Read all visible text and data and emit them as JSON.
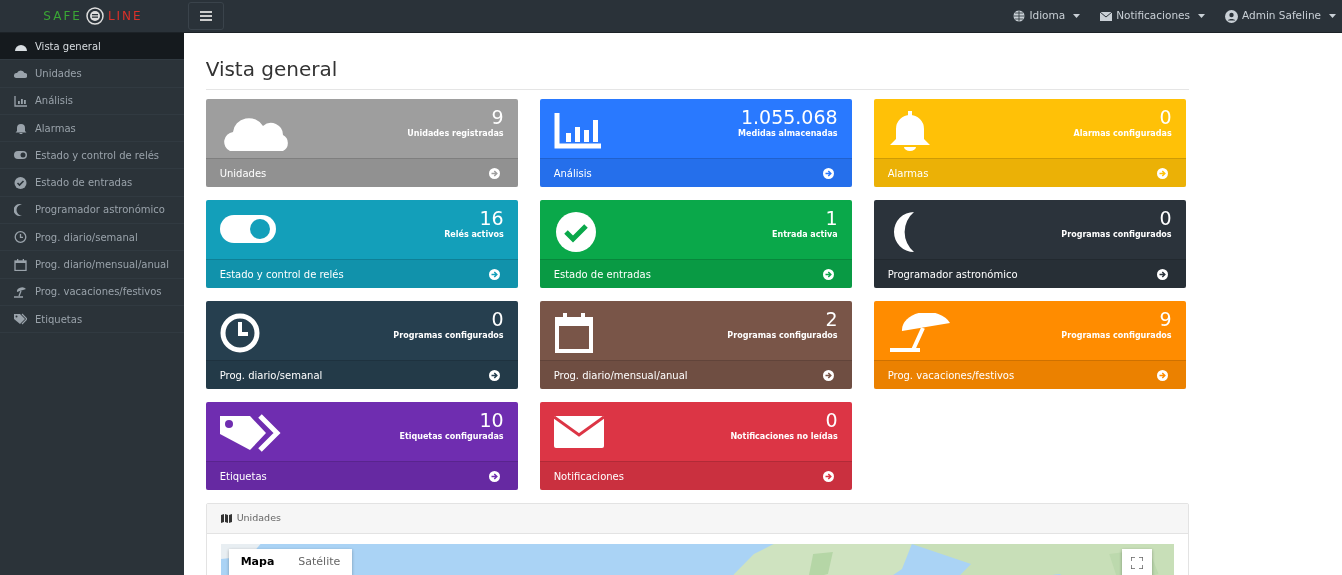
{
  "brand": {
    "left": "SAFE",
    "right": "LINE"
  },
  "topbar": {
    "menus": [
      {
        "label": "Idioma"
      },
      {
        "label": "Notificaciones"
      },
      {
        "label": "Admin Safeline"
      }
    ]
  },
  "sidebar": {
    "items": [
      {
        "label": "Vista general",
        "selected": true
      },
      {
        "label": "Unidades",
        "selected": false
      },
      {
        "label": "Análisis",
        "selected": false
      },
      {
        "label": "Alarmas",
        "selected": false
      },
      {
        "label": "Estado y control de relés",
        "selected": false
      },
      {
        "label": "Estado de entradas",
        "selected": false
      },
      {
        "label": "Programador astronómico",
        "selected": false
      },
      {
        "label": "Prog. diario/semanal",
        "selected": false
      },
      {
        "label": "Prog. diario/mensual/anual",
        "selected": false
      },
      {
        "label": "Prog. vacaciones/festivos",
        "selected": false
      },
      {
        "label": "Etiquetas",
        "selected": false
      }
    ]
  },
  "page_title": "Vista general",
  "cards": [
    {
      "value": "9",
      "caption": "Unidades registradas",
      "link": "Unidades",
      "color": "#9e9e9e"
    },
    {
      "value": "1.055.068",
      "caption": "Medidas almacenadas",
      "link": "Análisis",
      "color": "#2979ff"
    },
    {
      "value": "0",
      "caption": "Alarmas configuradas",
      "link": "Alarmas",
      "color": "#ffc107"
    },
    {
      "value": "16",
      "caption": "Relés activos",
      "link": "Estado y control de relés",
      "color": "#139fba"
    },
    {
      "value": "1",
      "caption": "Entrada activa",
      "link": "Estado de entradas",
      "color": "#0aa84a"
    },
    {
      "value": "0",
      "caption": "Programas configurados",
      "link": "Programador astronómico",
      "color": "#2b333b"
    },
    {
      "value": "0",
      "caption": "Programas configurados",
      "link": "Prog. diario/semanal",
      "color": "#263f4f"
    },
    {
      "value": "2",
      "caption": "Programas configurados",
      "link": "Prog. diario/mensual/anual",
      "color": "#795548"
    },
    {
      "value": "9",
      "caption": "Programas configurados",
      "link": "Prog. vacaciones/festivos",
      "color": "#ff8c00"
    },
    {
      "value": "10",
      "caption": "Etiquetas configuradas",
      "link": "Etiquetas",
      "color": "#6f2db0"
    },
    {
      "value": "0",
      "caption": "Notificaciones no leídas",
      "link": "Notificaciones",
      "color": "#dc3545"
    }
  ],
  "map_panel": {
    "title": "Unidades",
    "map_types": [
      {
        "label": "Mapa",
        "selected": true
      },
      {
        "label": "Satélite",
        "selected": false
      }
    ]
  }
}
